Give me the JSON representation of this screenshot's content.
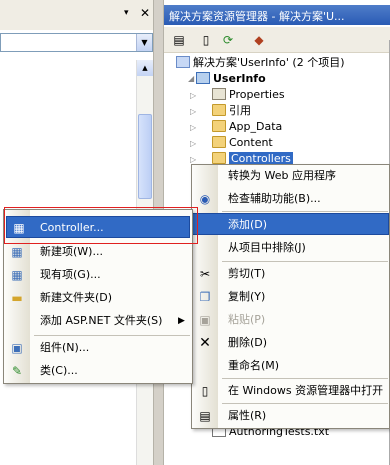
{
  "editor": {
    "pin_glyph": "▾",
    "close_glyph": "✕",
    "combo_arrow_glyph": "▼",
    "scroll_up_glyph": "▲"
  },
  "solution_explorer": {
    "title": "解决方案资源管理器 - 解决方案'U...",
    "tree": {
      "solution": "解决方案'UserInfo' (2 个项目)",
      "project": "UserInfo",
      "items": [
        "Properties",
        "引用",
        "App_Data",
        "Content",
        "Controllers"
      ],
      "footer_item": "AuthoringTests.txt"
    }
  },
  "context_menu": {
    "items": [
      "转换为 Web 应用程序",
      "检查辅助功能(B)...",
      "添加(D)",
      "从项目中排除(J)",
      "剪切(T)",
      "复制(Y)",
      "粘贴(P)",
      "删除(D)",
      "重命名(M)",
      "在 Windows 资源管理器中打开",
      "属性(R)"
    ]
  },
  "add_submenu": {
    "items": [
      "Controller...",
      "新建项(W)...",
      "现有项(G)...",
      "新建文件夹(D)",
      "添加 ASP.NET 文件夹(S)",
      "组件(N)...",
      "类(C)..."
    ],
    "submenu_arrow_glyph": "▶"
  },
  "colors": {
    "highlight": "#316ac5",
    "title_bar": "#2a5bb4",
    "annotation_box": "#e02020"
  }
}
